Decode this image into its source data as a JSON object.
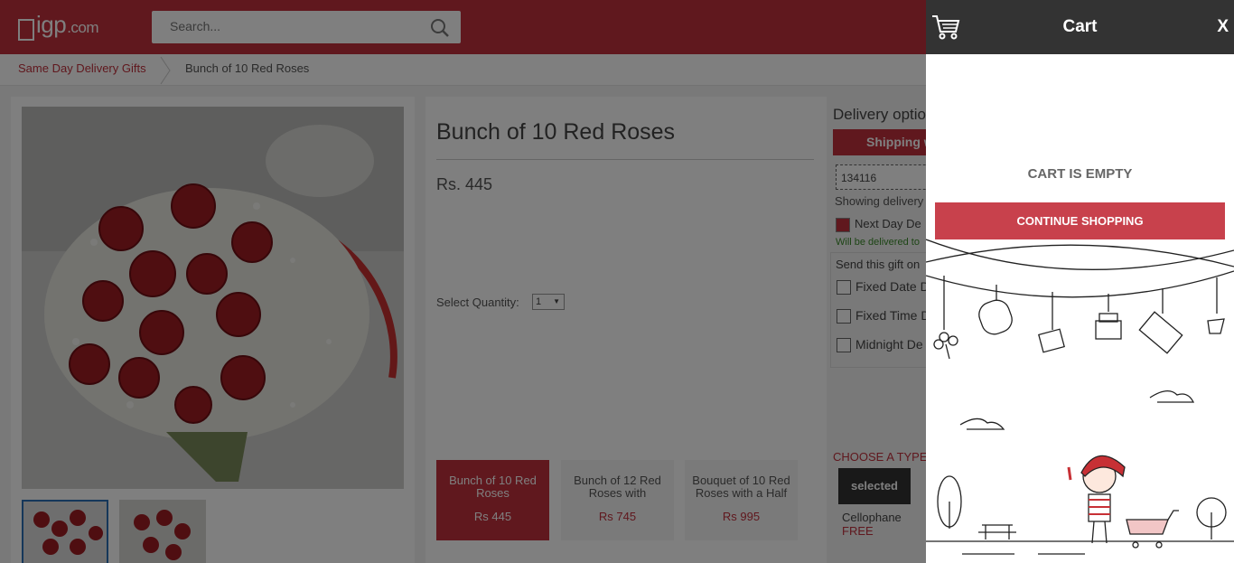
{
  "header": {
    "logo_text": "igp",
    "logo_suffix": ".com",
    "search_placeholder": "Search..."
  },
  "breadcrumb": {
    "items": [
      "Same Day Delivery Gifts",
      "Bunch of 10 Red Roses"
    ]
  },
  "product": {
    "title": "Bunch of 10 Red Roses",
    "price": "Rs. 445",
    "quantity_label": "Select Quantity:",
    "quantity_value": "1",
    "variants": [
      {
        "name": "Bunch of 10 Red Roses",
        "price": "Rs 445"
      },
      {
        "name": "Bunch of 12 Red Roses with",
        "price": "Rs 745"
      },
      {
        "name": "Bouquet of 10 Red Roses with a Half",
        "price": "Rs 995"
      }
    ]
  },
  "delivery": {
    "title": "Delivery optio",
    "shipping_button": "Shipping w",
    "pincode": "134116",
    "showing": "Showing delivery",
    "next_day": "Next Day De",
    "will_deliver": "Will be delivered to",
    "send_title": "Send this gift on",
    "options": [
      "Fixed Date D",
      "Fixed Time D",
      "Midnight De"
    ],
    "choose_type": "CHOOSE A TYPE O",
    "wrap_badge": "selected",
    "wrap_name": "Cellophane",
    "wrap_price": "FREE"
  },
  "cart": {
    "title": "Cart",
    "close": "X",
    "empty_text": "CART IS EMPTY",
    "continue_label": "CONTINUE SHOPPING"
  },
  "colors": {
    "brand_red": "#c0303c",
    "cart_header": "#333333",
    "continue_button": "#c8414c"
  }
}
